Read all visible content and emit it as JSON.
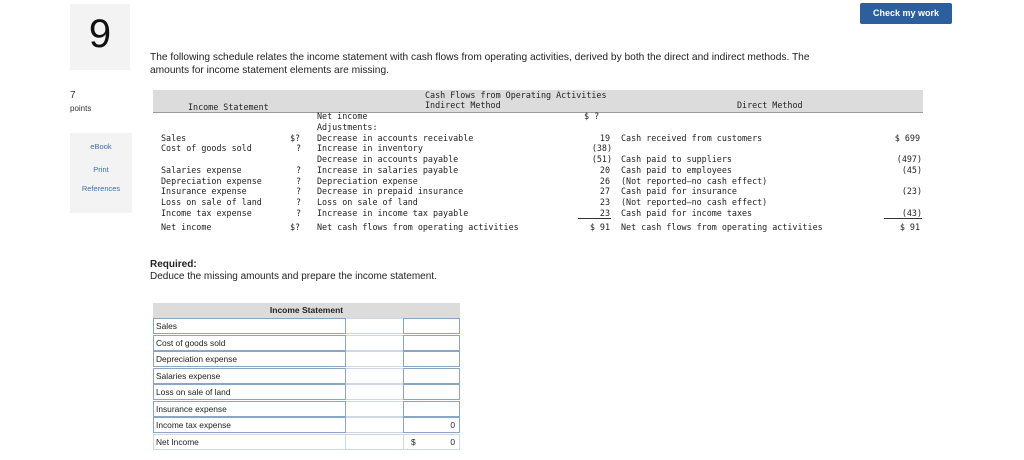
{
  "question": {
    "number": "9",
    "points_value": "7",
    "points_label": "points"
  },
  "side_links": [
    "eBook",
    "Print",
    "References"
  ],
  "check_button": "Check my work",
  "intro": "The following schedule relates the income statement with cash flows from operating activities, derived by both the direct and indirect methods. The amounts for income statement elements are missing.",
  "schedule": {
    "col_income_statement": "Income Statement",
    "col_cash_flows": "Cash Flows from Operating Activities",
    "col_indirect": "Indirect Method",
    "col_direct": "Direct Method",
    "income_statement": [
      {
        "label": "Sales",
        "value": "$?"
      },
      {
        "label": "Cost of goods sold",
        "value": "?"
      },
      {
        "label": "Salaries expense",
        "value": "?"
      },
      {
        "label": "Depreciation expense",
        "value": "?"
      },
      {
        "label": "Insurance expense",
        "value": "?"
      },
      {
        "label": "Loss on sale of land",
        "value": "?"
      },
      {
        "label": "Income tax expense",
        "value": "?"
      },
      {
        "label": "Net income",
        "value": "$?"
      }
    ],
    "indirect": [
      {
        "label": "Net income",
        "value": "$  ?"
      },
      {
        "label": "Adjustments:",
        "value": ""
      },
      {
        "label": "Decrease in accounts receivable",
        "value": "19"
      },
      {
        "label": "Increase in inventory",
        "value": "(38)"
      },
      {
        "label": "Decrease in accounts payable",
        "value": "(51)"
      },
      {
        "label": "Increase in salaries payable",
        "value": "20"
      },
      {
        "label": "Depreciation expense",
        "value": "26"
      },
      {
        "label": "Decrease in prepaid insurance",
        "value": "27"
      },
      {
        "label": "Loss on sale of land",
        "value": "23"
      },
      {
        "label": "Increase in income tax payable",
        "value": "23"
      },
      {
        "label": "Net cash flows from operating activities",
        "value": "$ 91"
      }
    ],
    "direct": [
      {
        "label": "Cash received from customers",
        "value": "$ 699"
      },
      {
        "label": "Cash paid to suppliers",
        "value": "(497)"
      },
      {
        "label": "Cash paid to employees",
        "value": "(45)"
      },
      {
        "label": "(Not reported—no cash effect)",
        "value": ""
      },
      {
        "label": "Cash paid for insurance",
        "value": "(23)"
      },
      {
        "label": "(Not reported—no cash effect)",
        "value": ""
      },
      {
        "label": "Cash paid for income taxes",
        "value": "(43)"
      },
      {
        "label": "Net cash flows from operating activities",
        "value": "$  91"
      }
    ]
  },
  "required": {
    "title": "Required:",
    "text": "Deduce the missing amounts and prepare the income statement."
  },
  "income_statement_form": {
    "header": "Income Statement",
    "rows": [
      {
        "label": "Sales",
        "value": ""
      },
      {
        "label": "Cost of goods sold",
        "value": ""
      },
      {
        "label": "Depreciation expense",
        "value": ""
      },
      {
        "label": "Salaries expense",
        "value": ""
      },
      {
        "label": "Loss on sale of land",
        "value": ""
      },
      {
        "label": "Insurance expense",
        "value": ""
      },
      {
        "label": "Income tax expense",
        "value": "0"
      },
      {
        "label": "Net Income",
        "dollar": "$",
        "value": "0"
      }
    ]
  }
}
